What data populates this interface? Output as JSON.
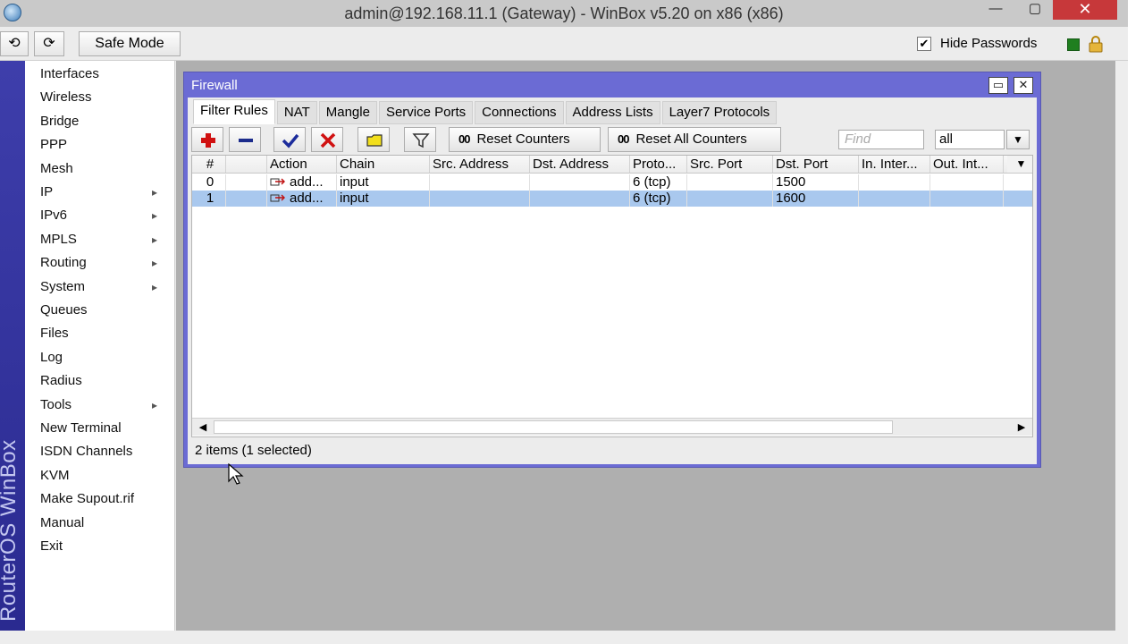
{
  "window": {
    "title": "admin@192.168.11.1 (Gateway) - WinBox v5.20 on x86 (x86)",
    "minimize": "—",
    "maximize": "▢",
    "close": "✕"
  },
  "toolbar": {
    "undo": "⟲",
    "redo": "⟳",
    "safe_mode": "Safe Mode",
    "hide_passwords_label": "Hide Passwords",
    "hide_passwords_checked": "✔"
  },
  "brand": "RouterOS WinBox",
  "menu": [
    {
      "label": "Interfaces",
      "submenu": ""
    },
    {
      "label": "Wireless",
      "submenu": ""
    },
    {
      "label": "Bridge",
      "submenu": ""
    },
    {
      "label": "PPP",
      "submenu": ""
    },
    {
      "label": "Mesh",
      "submenu": ""
    },
    {
      "label": "IP",
      "submenu": "▸"
    },
    {
      "label": "IPv6",
      "submenu": "▸"
    },
    {
      "label": "MPLS",
      "submenu": "▸"
    },
    {
      "label": "Routing",
      "submenu": "▸"
    },
    {
      "label": "System",
      "submenu": "▸"
    },
    {
      "label": "Queues",
      "submenu": ""
    },
    {
      "label": "Files",
      "submenu": ""
    },
    {
      "label": "Log",
      "submenu": ""
    },
    {
      "label": "Radius",
      "submenu": ""
    },
    {
      "label": "Tools",
      "submenu": "▸"
    },
    {
      "label": "New Terminal",
      "submenu": ""
    },
    {
      "label": "ISDN Channels",
      "submenu": ""
    },
    {
      "label": "KVM",
      "submenu": ""
    },
    {
      "label": "Make Supout.rif",
      "submenu": ""
    },
    {
      "label": "Manual",
      "submenu": ""
    },
    {
      "label": "Exit",
      "submenu": ""
    }
  ],
  "firewall": {
    "title": "Firewall",
    "max_btn": "▭",
    "close_btn": "✕",
    "tabs": [
      "Filter Rules",
      "NAT",
      "Mangle",
      "Service Ports",
      "Connections",
      "Address Lists",
      "Layer7 Protocols"
    ],
    "active_tab": "Filter Rules",
    "reset_counters": "Reset Counters",
    "reset_all_counters": "Reset All Counters",
    "counter_icon": "00",
    "find_placeholder": "Find",
    "filter_value": "all",
    "columns": [
      "#",
      "",
      "Action",
      "Chain",
      "Src. Address",
      "Dst. Address",
      "Proto...",
      "Src. Port",
      "Dst. Port",
      "In. Inter...",
      "Out. Int...",
      ""
    ],
    "rows": [
      {
        "num": "0",
        "action": "add...",
        "chain": "input",
        "src": "",
        "dst": "",
        "proto": "6 (tcp)",
        "sport": "",
        "dport": "1500",
        "in": "",
        "out": "",
        "selected": false
      },
      {
        "num": "1",
        "action": "add...",
        "chain": "input",
        "src": "",
        "dst": "",
        "proto": "6 (tcp)",
        "sport": "",
        "dport": "1600",
        "in": "",
        "out": "",
        "selected": true
      }
    ],
    "status": "2 items (1 selected)"
  },
  "colors": {
    "brand_blue": "#3e3eab",
    "window_title": "#6b6bd4",
    "selection": "#a9c8ee",
    "close_red": "#c7383a"
  }
}
